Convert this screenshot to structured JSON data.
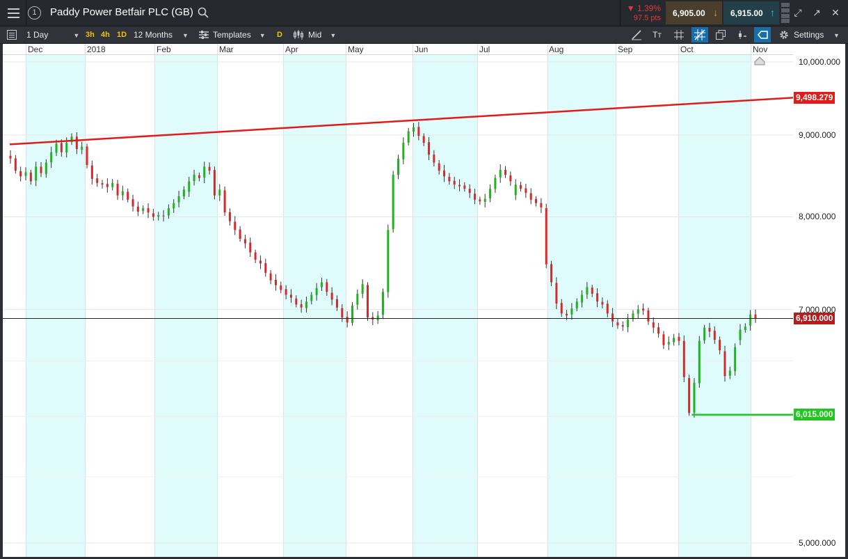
{
  "window": {
    "title": "Paddy Power Betfair PLC (GB)",
    "panel_number": "1",
    "change_pct": "▼ 1.39%",
    "change_pts": "97.5 pts",
    "sell_price": "6,905.00",
    "buy_price": "6,915.00",
    "colors": {
      "down": "#e03a3a",
      "sell_bg": "#4a3e2c",
      "buy_bg": "#223f4a",
      "sell_arrow": "#e8a020",
      "buy_arrow": "#3fc6d8"
    },
    "icons": [
      "menu-icon",
      "search-icon",
      "volume-icon",
      "expand-icon",
      "popout-icon",
      "close-icon"
    ]
  },
  "toolbar": {
    "interval": "1 Day",
    "quick_intervals": [
      "3h",
      "4h",
      "1D"
    ],
    "range": "12 Months",
    "templates": "Templates",
    "d_button": "D",
    "price_type": "Mid",
    "settings": "Settings"
  },
  "chart_data": {
    "type": "candlestick",
    "x_axis_labels": [
      "Dec",
      "2018",
      "Feb",
      "Mar",
      "Apr",
      "May",
      "Jun",
      "Jul",
      "Aug",
      "Sep",
      "Oct",
      "Nov"
    ],
    "y_ticks": [
      "10,000.000",
      "9,000.000",
      "8,000.000",
      "7,000.000",
      "5,000.000"
    ],
    "y_tick_values": [
      10000,
      9000,
      8000,
      7000,
      5000
    ],
    "y_scale": "log",
    "ylim": [
      4900,
      10100
    ],
    "current_price": 6910,
    "current_price_label": "6,910.000",
    "resistance_label": "9,498.279",
    "support_label": "6,015.000",
    "resistance_line": [
      {
        "x": "2017-11-24",
        "y": 8880
      },
      {
        "x": "2018-11-07",
        "y": 9498.279
      }
    ],
    "support_line": [
      {
        "x": "2018-10-08",
        "y": 6015
      },
      {
        "x": "2018-11-07",
        "y": 6015
      }
    ],
    "colors": {
      "up": "#21b221",
      "down": "#d62a2a",
      "resistance": "#e31a1a",
      "support": "#1ec81e",
      "shade": "#e0fbfb"
    },
    "shaded_months": [
      "Dec",
      "Feb",
      "Apr",
      "Jun",
      "Aug",
      "Oct"
    ],
    "closes": [
      8700,
      8550,
      8480,
      8530,
      8420,
      8600,
      8520,
      8650,
      8780,
      8890,
      8780,
      8900,
      8980,
      8820,
      8850,
      8620,
      8450,
      8400,
      8380,
      8350,
      8400,
      8250,
      8300,
      8200,
      8120,
      8060,
      8100,
      8050,
      8000,
      8020,
      8010,
      8100,
      8160,
      8240,
      8320,
      8420,
      8500,
      8460,
      8600,
      8550,
      8250,
      8320,
      8050,
      7950,
      7850,
      7750,
      7700,
      7600,
      7520,
      7480,
      7380,
      7300,
      7250,
      7200,
      7150,
      7120,
      7050,
      7020,
      7080,
      7150,
      7220,
      7280,
      7180,
      7100,
      7020,
      6920,
      6870,
      7040,
      7160,
      7260,
      6920,
      6900,
      6940,
      7180,
      7850,
      8500,
      8700,
      8900,
      9050,
      9100,
      8990,
      8900,
      8750,
      8650,
      8550,
      8480,
      8420,
      8380,
      8360,
      8330,
      8280,
      8200,
      8180,
      8210,
      8330,
      8460,
      8560,
      8500,
      8420,
      8380,
      8330,
      8280,
      8200,
      8160,
      8110,
      7470,
      7280,
      7060,
      6960,
      6940,
      7010,
      7080,
      7150,
      7230,
      7160,
      7080,
      7050,
      6960,
      6880,
      6840,
      6830,
      6900,
      6960,
      7000,
      6990,
      6880,
      6820,
      6760,
      6650,
      6680,
      6720,
      6690,
      6350,
      6030,
      6300,
      6690,
      6820,
      6780,
      6700,
      6600,
      6360,
      6410,
      6630,
      6800,
      6830,
      6950,
      6910
    ]
  }
}
